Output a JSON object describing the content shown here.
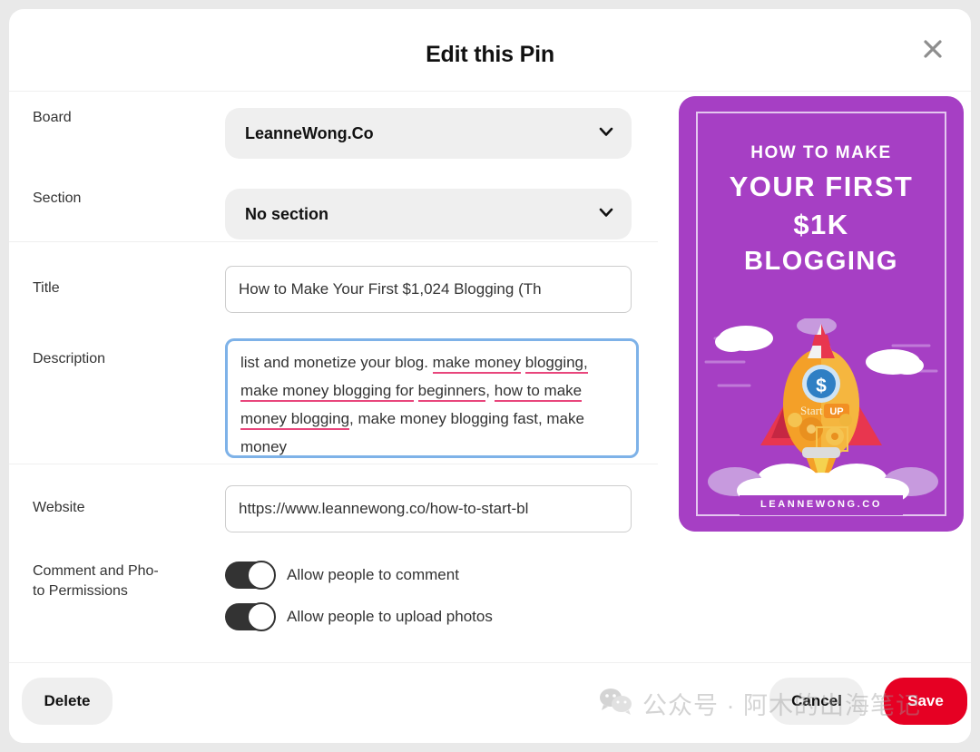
{
  "header": {
    "title": "Edit this Pin",
    "close_icon": "close-icon"
  },
  "form": {
    "board": {
      "label": "Board",
      "value": "LeanneWong.Co",
      "chevron_icon": "chevron-down-icon"
    },
    "section": {
      "label": "Section",
      "value": "No section",
      "chevron_icon": "chevron-down-icon"
    },
    "title": {
      "label": "Title",
      "value": "How to Make Your First $1,024 Blogging (Th"
    },
    "description": {
      "label": "Description",
      "line1_plain": "list and monetize your blog. ",
      "line1_spell": "make money",
      "line2_spell_a": "blogging,",
      "line2_plain_a": " ",
      "line2_spell_b": "make money blogging for",
      "line3_spell_a": "beginners",
      "line3_plain_a": ", ",
      "line3_spell_b": "how to make money blogging",
      "line3_plain_b": ",",
      "line4_plain": "make money blogging fast, make money"
    },
    "website": {
      "label": "Website",
      "value": "https://www.leannewong.co/how-to-start-bl"
    },
    "permissions": {
      "label": "Comment and Pho-",
      "label2": "to Permissions",
      "toggles": [
        {
          "label": "Allow people to comment",
          "on": true
        },
        {
          "label": "Allow people to upload photos",
          "on": true
        }
      ]
    }
  },
  "preview": {
    "line1": "HOW TO MAKE",
    "line2": "YOUR FIRST",
    "line3": "$1K",
    "line4": "BLOGGING",
    "footer": "LEANNEWONG.CO",
    "badge_text": "Start",
    "badge_text2": "UP",
    "bg_color": "#a63fc4"
  },
  "footer": {
    "delete_label": "Delete",
    "cancel_label": "Cancel",
    "save_label": "Save",
    "save_color": "#e60023"
  },
  "watermark": {
    "text": "公众号 · 阿木的出海笔记",
    "icon": "wechat-icon"
  }
}
